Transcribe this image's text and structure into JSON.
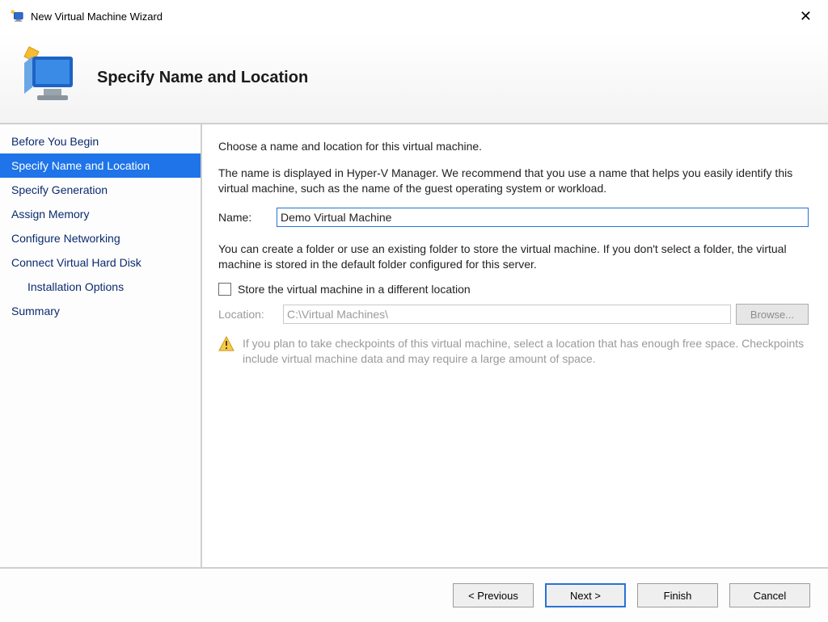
{
  "window": {
    "title": "New Virtual Machine Wizard",
    "page_heading": "Specify Name and Location"
  },
  "sidebar": {
    "items": [
      {
        "label": "Before You Begin",
        "indent": false,
        "active": false
      },
      {
        "label": "Specify Name and Location",
        "indent": false,
        "active": true
      },
      {
        "label": "Specify Generation",
        "indent": false,
        "active": false
      },
      {
        "label": "Assign Memory",
        "indent": false,
        "active": false
      },
      {
        "label": "Configure Networking",
        "indent": false,
        "active": false
      },
      {
        "label": "Connect Virtual Hard Disk",
        "indent": false,
        "active": false
      },
      {
        "label": "Installation Options",
        "indent": true,
        "active": false
      },
      {
        "label": "Summary",
        "indent": false,
        "active": false
      }
    ]
  },
  "main": {
    "intro": "Choose a name and location for this virtual machine.",
    "name_help": "The name is displayed in Hyper-V Manager. We recommend that you use a name that helps you easily identify this virtual machine, such as the name of the guest operating system or workload.",
    "name_label": "Name:",
    "name_value": "Demo Virtual Machine",
    "loc_para": "You can create a folder or use an existing folder to store the virtual machine. If you don't select a folder, the virtual machine is stored in the default folder configured for this server.",
    "store_checkbox_label": "Store the virtual machine in a different location",
    "store_checkbox_checked": false,
    "location_label": "Location:",
    "location_value": "C:\\Virtual Machines\\",
    "browse_label": "Browse...",
    "warning_text": "If you plan to take checkpoints of this virtual machine, select a location that has enough free space. Checkpoints include virtual machine data and may require a large amount of space."
  },
  "footer": {
    "previous": "< Previous",
    "next": "Next >",
    "finish": "Finish",
    "cancel": "Cancel"
  }
}
